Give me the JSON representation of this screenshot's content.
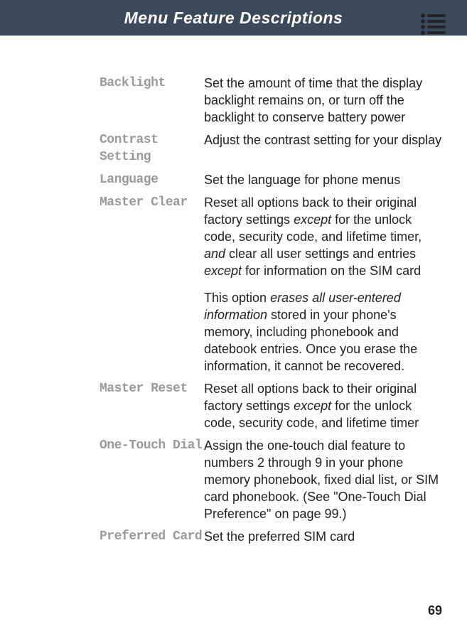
{
  "header": {
    "title": "Menu Feature Descriptions"
  },
  "rows": [
    {
      "term": "Backlight",
      "paras": [
        {
          "segments": [
            {
              "text": "Set the amount of time that the display backlight remains on, or turn off the backlight to conserve battery power",
              "italic": false
            }
          ]
        }
      ]
    },
    {
      "term": "Contrast Setting",
      "paras": [
        {
          "segments": [
            {
              "text": "Adjust the contrast setting for your display",
              "italic": false
            }
          ]
        }
      ]
    },
    {
      "term": "Language",
      "paras": [
        {
          "segments": [
            {
              "text": "Set the language for phone menus",
              "italic": false
            }
          ]
        }
      ]
    },
    {
      "term": "Master Clear",
      "paras": [
        {
          "segments": [
            {
              "text": "Reset all options back to their original factory settings ",
              "italic": false
            },
            {
              "text": "except",
              "italic": true
            },
            {
              "text": " for the unlock code, security code, and lifetime timer, ",
              "italic": false
            },
            {
              "text": "and",
              "italic": true
            },
            {
              "text": " clear all user settings and entries ",
              "italic": false
            },
            {
              "text": "except",
              "italic": true
            },
            {
              "text": " for information on the SIM card",
              "italic": false
            }
          ]
        },
        {
          "segments": [
            {
              "text": "This option ",
              "italic": false
            },
            {
              "text": "erases all user-entered information",
              "italic": true
            },
            {
              "text": " stored in your phone's memory, including phonebook and datebook entries. Once you erase the information, it cannot be recovered.",
              "italic": false
            }
          ]
        }
      ]
    },
    {
      "term": "Master Reset",
      "paras": [
        {
          "segments": [
            {
              "text": "Reset all options back to their original factory settings ",
              "italic": false
            },
            {
              "text": "except",
              "italic": true
            },
            {
              "text": " for the unlock code, security code, and lifetime timer",
              "italic": false
            }
          ]
        }
      ]
    },
    {
      "term": "One-Touch Dial",
      "paras": [
        {
          "segments": [
            {
              "text": "Assign the one-touch dial feature to numbers 2 through 9 in your phone memory phonebook, fixed dial list, or SIM card phonebook. (See \"One-Touch Dial Preference\" on page 99.)",
              "italic": false
            }
          ]
        }
      ]
    },
    {
      "term": "Preferred Card",
      "paras": [
        {
          "segments": [
            {
              "text": "Set the preferred SIM card",
              "italic": false
            }
          ]
        }
      ]
    }
  ],
  "pageNumber": "69"
}
